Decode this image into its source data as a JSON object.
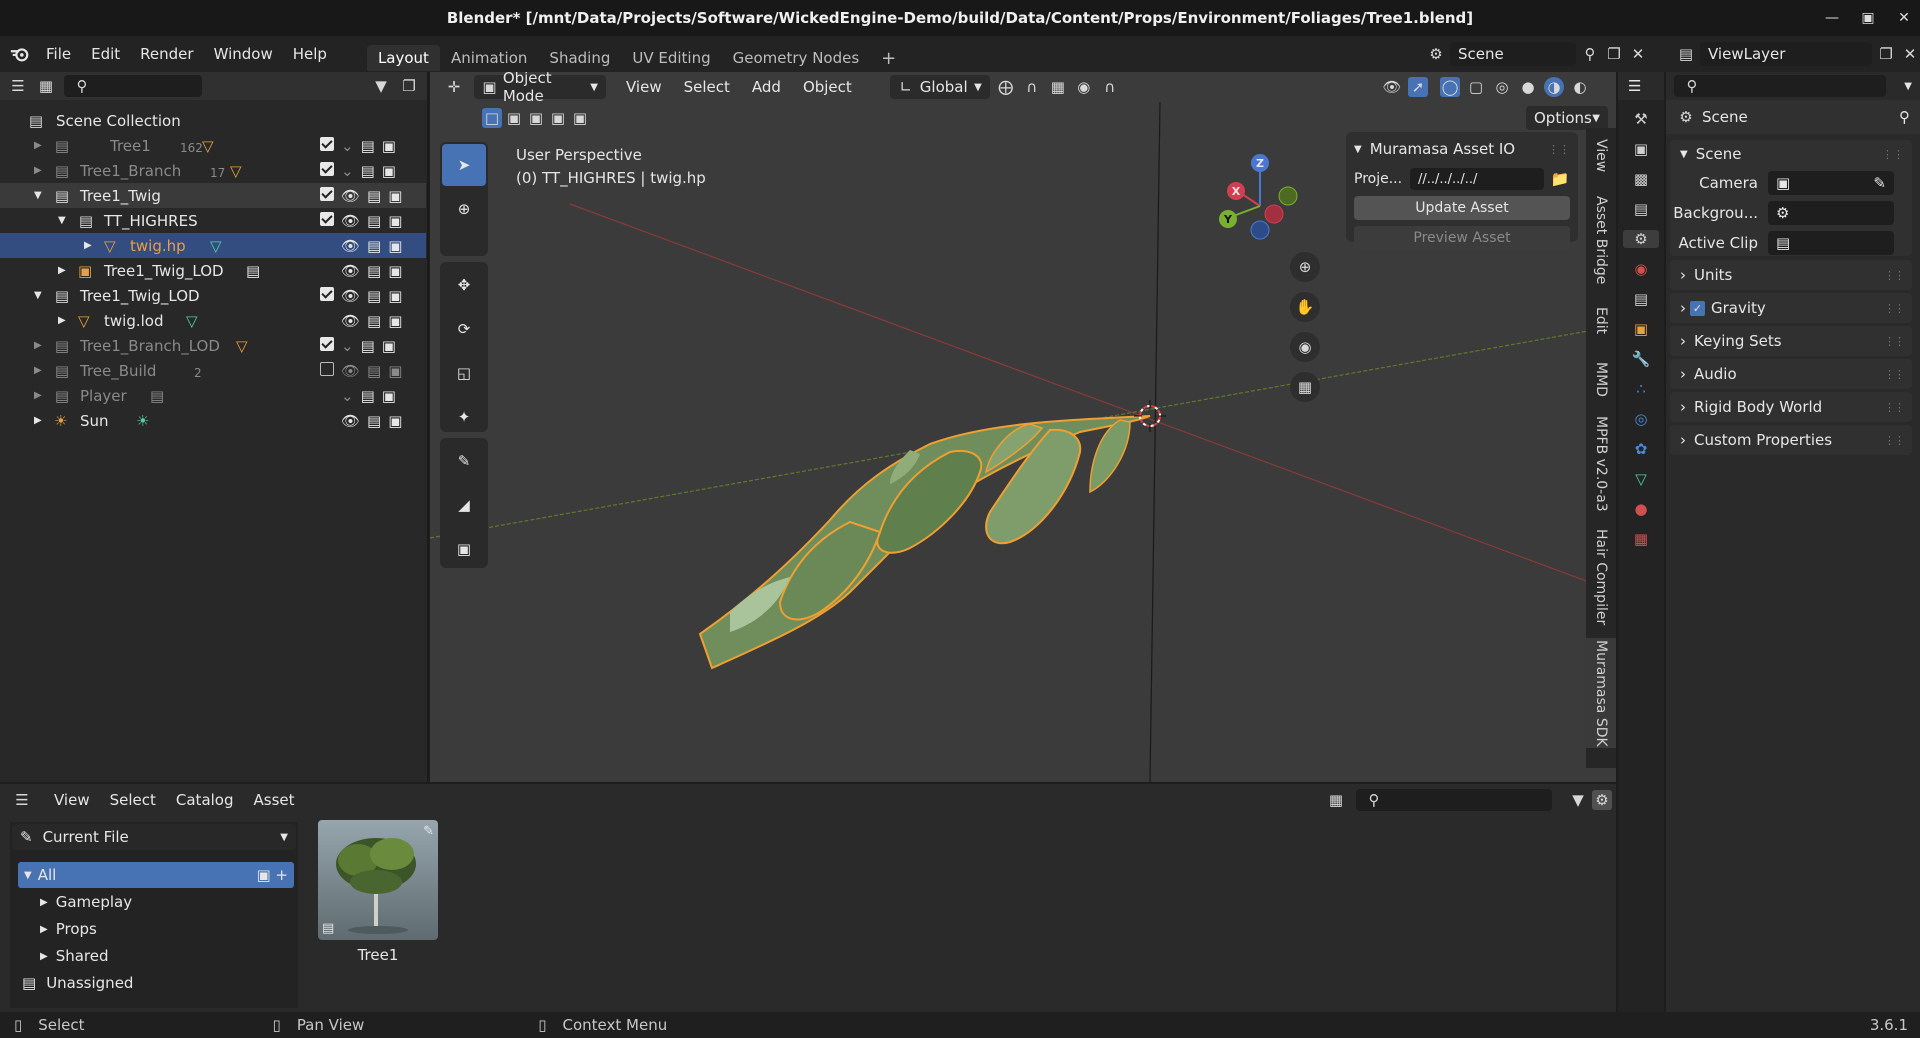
{
  "window": {
    "title": "Blender* [/mnt/Data/Projects/Software/WickedEngine-Demo/build/Data/Content/Props/Environment/Foliages/Tree1.blend]"
  },
  "menu": {
    "file": "File",
    "edit": "Edit",
    "render": "Render",
    "window": "Window",
    "help": "Help"
  },
  "workspaces": [
    "Layout",
    "Animation",
    "Shading",
    "UV Editing",
    "Geometry Nodes"
  ],
  "scene_selector": {
    "value": "Scene"
  },
  "viewlayer_selector": {
    "value": "ViewLayer"
  },
  "outliner": {
    "root": "Scene Collection",
    "rows": [
      {
        "label": "Tree1",
        "count": "162"
      },
      {
        "label": "Tree1_Branch",
        "count": "17"
      },
      {
        "label": "Tree1_Twig"
      },
      {
        "label": "TT_HIGHRES"
      },
      {
        "label": "twig.hp"
      },
      {
        "label": "Tree1_Twig_LOD"
      },
      {
        "label": "Tree1_Twig_LOD"
      },
      {
        "label": "twig.lod"
      },
      {
        "label": "Tree1_Branch_LOD"
      },
      {
        "label": "Tree_Build",
        "count": "2"
      },
      {
        "label": "Player"
      },
      {
        "label": "Sun"
      }
    ]
  },
  "viewport": {
    "mode": "Object Mode",
    "menus": [
      "View",
      "Select",
      "Add",
      "Object"
    ],
    "transform_orientation": "Global",
    "options": "Options",
    "info_line1": "User Perspective",
    "info_line2": "(0) TT_HIGHRES | twig.hp",
    "axis_x": "X",
    "axis_y": "Y",
    "axis_z": "Z"
  },
  "muramasa_panel": {
    "title": "Muramasa Asset IO",
    "project_label": "Proje...",
    "project_value": "//../../../../",
    "update_button": "Update Asset",
    "preview_button": "Preview Asset"
  },
  "side_tabs": [
    "View",
    "Asset Bridge",
    "Edit",
    "MMD",
    "MPFB v2.0-a3",
    "Hair Compiler",
    "Muramasa SDK"
  ],
  "properties": {
    "header": "Scene",
    "section": "Scene",
    "camera_label": "Camera",
    "background_label": "Backgrou...",
    "active_clip_label": "Active Clip",
    "panels": [
      "Units",
      "Gravity",
      "Keying Sets",
      "Audio",
      "Rigid Body World",
      "Custom Properties"
    ],
    "gravity_checked": true
  },
  "asset_browser": {
    "menus": [
      "View",
      "Select",
      "Catalog",
      "Asset"
    ],
    "library": "Current File",
    "catalogs": [
      "All",
      "Gameplay",
      "Props",
      "Shared",
      "Unassigned"
    ],
    "assets": [
      {
        "name": "Tree1"
      }
    ]
  },
  "status": {
    "select": "Select",
    "pan_view": "Pan View",
    "context_menu": "Context Menu",
    "version": "3.6.1"
  },
  "colors": {
    "accent": "#4772b3",
    "selection_orange": "#e8a040",
    "selected_row": "#334d80"
  }
}
